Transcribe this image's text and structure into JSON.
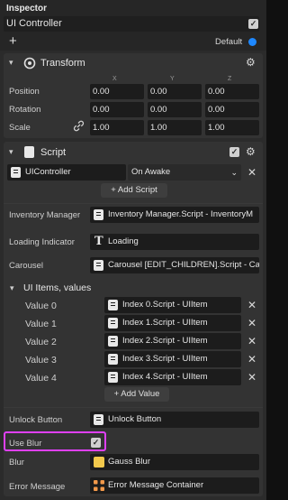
{
  "header": {
    "title": "Inspector",
    "object_name": "UI Controller",
    "layer": "Default",
    "add_label": "+"
  },
  "transform": {
    "title": "Transform",
    "axes": [
      "X",
      "Y",
      "Z"
    ],
    "position_label": "Position",
    "rotation_label": "Rotation",
    "scale_label": "Scale",
    "position": [
      "0.00",
      "0.00",
      "0.00"
    ],
    "rotation": [
      "0.00",
      "0.00",
      "0.00"
    ],
    "scale": [
      "1.00",
      "1.00",
      "1.00"
    ]
  },
  "script": {
    "title": "Script",
    "asset_name": "UIController",
    "event": "On Awake",
    "add_script_label": "+ Add Script",
    "inventory_manager_label": "Inventory Manager",
    "inventory_manager_value": "Inventory Manager.Script - InventoryM",
    "loading_indicator_label": "Loading Indicator",
    "loading_indicator_value": "Loading",
    "carousel_label": "Carousel",
    "carousel_value": "Carousel [EDIT_CHILDREN].Script - Ca",
    "ui_items_label": "UI Items, values",
    "ui_items": [
      {
        "label": "Value 0",
        "value": "Index 0.Script - UIItem"
      },
      {
        "label": "Value 1",
        "value": "Index 1.Script - UIItem"
      },
      {
        "label": "Value 2",
        "value": "Index 2.Script - UIItem"
      },
      {
        "label": "Value 3",
        "value": "Index 3.Script - UIItem"
      },
      {
        "label": "Value 4",
        "value": "Index 4.Script - UIItem"
      }
    ],
    "add_value_label": "+ Add Value",
    "unlock_button_label": "Unlock Button",
    "unlock_button_value": "Unlock Button",
    "use_blur_label": "Use Blur",
    "use_blur_checked": true,
    "blur_label": "Blur",
    "blur_value": "Gauss Blur",
    "error_message_label": "Error Message",
    "error_message_value": "Error Message Container"
  },
  "colors": {
    "accent": "#1e88ff",
    "highlight": "#e040fb",
    "blur_icon": "#f2c94c",
    "error_icon": "#f2994a"
  }
}
